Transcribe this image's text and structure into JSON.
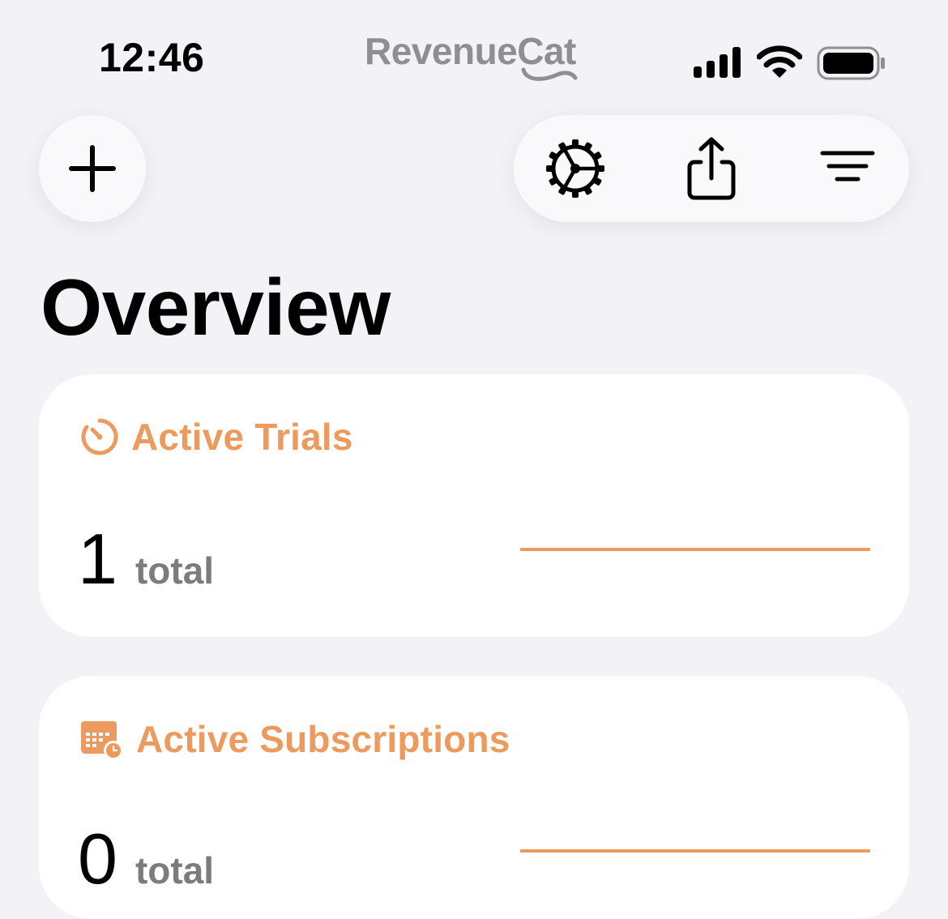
{
  "status_bar": {
    "time": "12:46",
    "brand": "RevenueCat"
  },
  "page": {
    "title": "Overview"
  },
  "cards": [
    {
      "title": "Active Trials",
      "icon": "timer-icon",
      "value": "1",
      "unit": "total"
    },
    {
      "title": "Active Subscriptions",
      "icon": "calendar-icon",
      "value": "0",
      "unit": "total"
    }
  ],
  "colors": {
    "accent": "#ec9a5e",
    "background": "#f2f2f7",
    "card": "#ffffff",
    "secondary_text": "#7b7b80",
    "brand_gray": "#8e8e93"
  }
}
